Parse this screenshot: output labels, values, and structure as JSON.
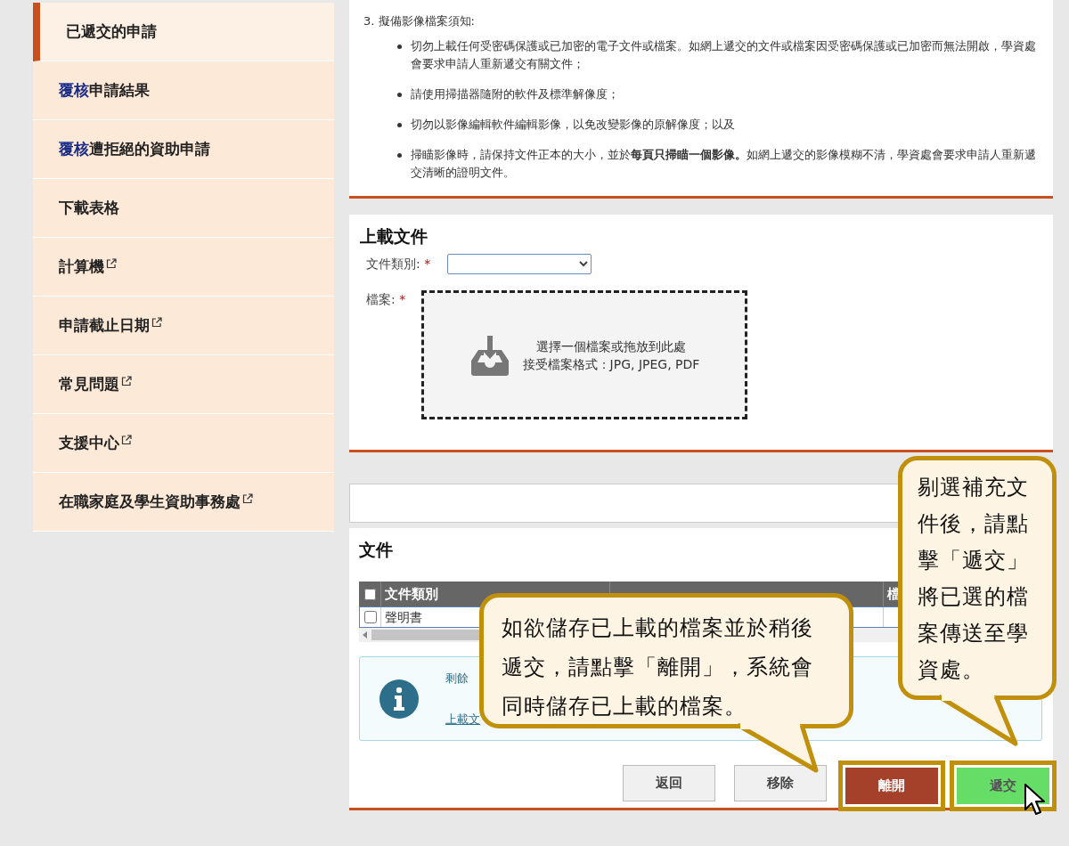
{
  "sidebar": {
    "items": [
      {
        "label": "已遞交的申請",
        "external": false,
        "selected": true
      },
      {
        "prefix": "覆核",
        "label": "申請結果",
        "external": false,
        "selected": false
      },
      {
        "prefix": "覆核",
        "label": "遭拒絕的資助申請",
        "external": false,
        "selected": false
      },
      {
        "label": "下載表格",
        "external": false,
        "selected": false
      },
      {
        "label": "計算機",
        "external": true,
        "selected": false
      },
      {
        "label": "申請截止日期",
        "external": true,
        "selected": false
      },
      {
        "label": "常見問題",
        "external": true,
        "selected": false
      },
      {
        "label": "支援中心",
        "external": true,
        "selected": false
      },
      {
        "label": "在職家庭及學生資助事務處",
        "external": true,
        "selected": false
      }
    ]
  },
  "notice": {
    "heading": "3. 擬備影像檔案須知:",
    "bullets": [
      "切勿上載任何受密碼保護或已加密的電子文件或檔案。如網上遞交的文件或檔案因受密碼保護或已加密而無法開啟，學資處會要求申請人重新遞交有關文件；",
      "請使用掃描器隨附的軟件及標準解像度；",
      "切勿以影像編輯軟件編輯影像，以免改變影像的原解像度；以及",
      "掃瞄影像時，請保持文件正本的大小，並於**每頁只掃瞄一個影像。**如網上遞交的影像模糊不清，學資處會要求申請人重新遞交清晰的證明文件。"
    ]
  },
  "upload": {
    "title": "上載文件",
    "category_label": "文件類別:",
    "file_label": "檔案:",
    "required_mark": "*",
    "dropzone": [
      "選擇一個檔案或拖放到此處",
      "接受檔案格式：JPG, JPEG, PDF"
    ]
  },
  "documents": {
    "title": "文件",
    "header_checked": false,
    "columns": [
      "文件類別",
      "檔"
    ],
    "rows": [
      {
        "checked": false,
        "cells": [
          "聲明書"
        ]
      }
    ],
    "info": [
      "剩餘",
      "上載文"
    ],
    "buttons": [
      {
        "label": "返回",
        "kind": "default",
        "highlighted": false
      },
      {
        "label": "移除",
        "kind": "default",
        "highlighted": false
      },
      {
        "label": "離開",
        "kind": "danger",
        "highlighted": true
      },
      {
        "label": "遞交",
        "kind": "success",
        "highlighted": true
      }
    ]
  },
  "callouts": [
    {
      "text": "如欲儲存已上載的檔案並於稍後遞交，請點擊「離開」，系統會同時儲存已上載的檔案。"
    },
    {
      "text": "剔選補充文件後，請點擊「遞交」將已選的檔案傳送至學資處。"
    }
  ]
}
